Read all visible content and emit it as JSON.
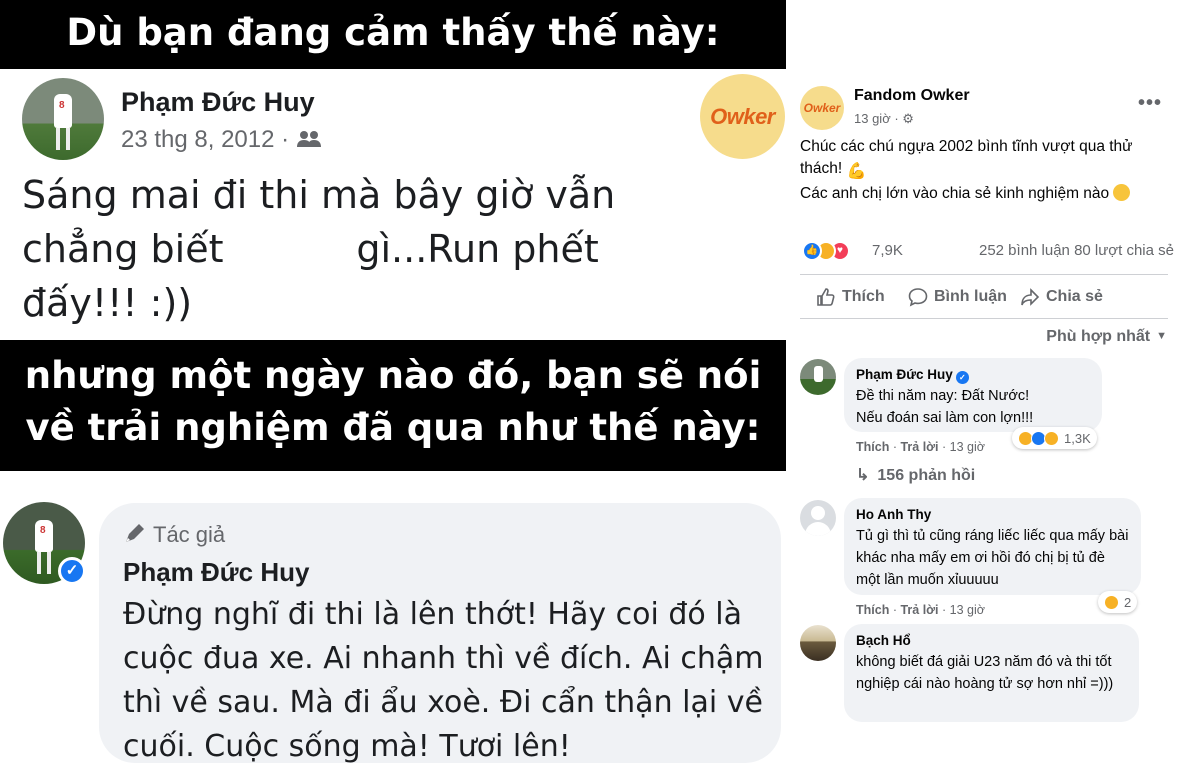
{
  "meme": {
    "top_banner": "Dù bạn đang cảm thấy thế này:",
    "old_post": {
      "author": "Phạm Đức Huy",
      "date": "23 thg 8, 2012 ·",
      "audience_icon": "friends-icon",
      "body": "Sáng mai đi thi mà bây giờ vẫn\nchẳng biết           gì...Run phết\nđấy!!! :))",
      "logo_text": "Owker"
    },
    "middle_banner_line1": "nhưng một ngày nào đó, bạn sẽ nói",
    "middle_banner_line2": "về trải nghiệm đã qua như thế này:",
    "author_reply": {
      "tag": "Tác giả",
      "author": "Phạm Đức Huy",
      "body": "Đừng nghĩ đi thi là lên thớt! Hãy coi đó là cuộc đua xe. Ai nhanh thì về đích. Ai chậm thì về sau. Mà đi ẩu xoè. Đi cẩn thận lại về cuối. Cuộc sống mà! Tươi lên!"
    }
  },
  "fb_post": {
    "page_name": "Fandom Owker",
    "avatar_text": "Owker",
    "time": "13 giờ",
    "more": "•••",
    "text_line1": "Chúc các chú ngựa 2002 bình tĩnh vượt qua thử thách!",
    "text_line2": "Các anh chị lớn vào chia sẻ kinh nghiệm nào",
    "reaction_count": "7,9K",
    "stats": "252 bình luận  80 lượt chia sẻ",
    "actions": {
      "like": "Thích",
      "comment": "Bình luận",
      "share": "Chia sẻ"
    },
    "sort_label": "Phù hợp nhất"
  },
  "comments": [
    {
      "name": "Phạm Đức Huy",
      "line1": "Đề thi năm nay: Đất Nước!",
      "line2": "Nếu đoán sai       làm con lợn!!!",
      "like": "Thích",
      "reply": "Trả lời",
      "time": "13 giờ",
      "reaction_count": "1,3K",
      "replies": "156 phản hồi"
    },
    {
      "name": "Ho Anh Thy",
      "text": "Tủ gì thì tủ cũng ráng liếc liếc qua mấy bài khác nha mấy em ơi hồi đó chị bị tủ đè một lần muốn xỉuuuuu",
      "like": "Thích",
      "reply": "Trả lời",
      "time": "13 giờ",
      "reaction_count": "2"
    },
    {
      "name": "Bạch Hổ",
      "text": "không biết đá giải U23 năm đó và thi tốt nghiệp cái nào hoàng tử sợ hơn nhỉ =)))"
    }
  ],
  "colors": {
    "accent_blue": "#1877f2",
    "meta_gray": "#65676b",
    "bubble_gray": "#f0f2f5",
    "owker_orange": "#e0601a"
  }
}
